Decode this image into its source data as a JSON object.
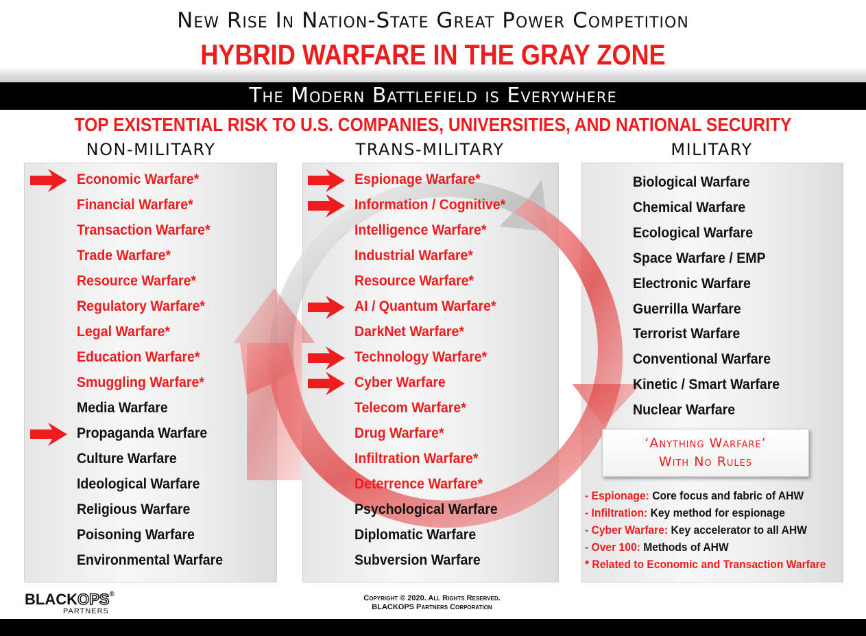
{
  "header": {
    "super_title": "New Rise In Nation-State Great Power Competition",
    "main_title": "HYBRID WARFARE IN THE GRAY ZONE",
    "band_title": "The Modern Battlefield is Everywhere",
    "risk_line": "TOP EXISTENTIAL RISK TO U.S. COMPANIES, UNIVERSITIES, AND NATIONAL SECURITY"
  },
  "colors": {
    "accent_red": "#ee1c1c",
    "text_black": "#111111",
    "panel_gray": "#eeeeee"
  },
  "columns": [
    {
      "heading": "NON-MILITARY",
      "items": [
        {
          "label": "Economic Warfare*",
          "color": "red",
          "arrow": true
        },
        {
          "label": "Financial Warfare*",
          "color": "red",
          "arrow": false
        },
        {
          "label": "Transaction Warfare*",
          "color": "red",
          "arrow": false
        },
        {
          "label": "Trade Warfare*",
          "color": "red",
          "arrow": false
        },
        {
          "label": "Resource Warfare*",
          "color": "red",
          "arrow": false
        },
        {
          "label": "Regulatory Warfare*",
          "color": "red",
          "arrow": false
        },
        {
          "label": "Legal Warfare*",
          "color": "red",
          "arrow": false
        },
        {
          "label": "Education Warfare*",
          "color": "red",
          "arrow": false
        },
        {
          "label": "Smuggling Warfare*",
          "color": "red",
          "arrow": false
        },
        {
          "label": "Media Warfare",
          "color": "black",
          "arrow": false
        },
        {
          "label": "Propaganda Warfare",
          "color": "black",
          "arrow": true
        },
        {
          "label": "Culture Warfare",
          "color": "black",
          "arrow": false
        },
        {
          "label": "Ideological Warfare",
          "color": "black",
          "arrow": false
        },
        {
          "label": "Religious Warfare",
          "color": "black",
          "arrow": false
        },
        {
          "label": "Poisoning Warfare",
          "color": "black",
          "arrow": false
        },
        {
          "label": "Environmental Warfare",
          "color": "black",
          "arrow": false
        }
      ]
    },
    {
      "heading": "TRANS-MILITARY",
      "items": [
        {
          "label": "Espionage Warfare*",
          "color": "red",
          "arrow": true
        },
        {
          "label": "Information / Cognitive*",
          "color": "red",
          "arrow": true
        },
        {
          "label": "Intelligence Warfare*",
          "color": "red",
          "arrow": false
        },
        {
          "label": "Industrial Warfare*",
          "color": "red",
          "arrow": false
        },
        {
          "label": "Resource Warfare*",
          "color": "red",
          "arrow": false
        },
        {
          "label": "AI / Quantum Warfare*",
          "color": "red",
          "arrow": true
        },
        {
          "label": "DarkNet Warfare*",
          "color": "red",
          "arrow": false
        },
        {
          "label": "Technology Warfare*",
          "color": "red",
          "arrow": true
        },
        {
          "label": "Cyber Warfare",
          "color": "red",
          "arrow": true
        },
        {
          "label": "Telecom Warfare*",
          "color": "red",
          "arrow": false
        },
        {
          "label": "Drug Warfare*",
          "color": "red",
          "arrow": false
        },
        {
          "label": "Infiltration Warfare*",
          "color": "red",
          "arrow": false
        },
        {
          "label": "Deterrence Warfare*",
          "color": "red",
          "arrow": false
        },
        {
          "label": "Psychological Warfare",
          "color": "black",
          "arrow": false
        },
        {
          "label": "Diplomatic Warfare",
          "color": "black",
          "arrow": false
        },
        {
          "label": "Subversion Warfare",
          "color": "black",
          "arrow": false
        }
      ]
    },
    {
      "heading": "MILITARY",
      "items": [
        {
          "label": "Biological Warfare",
          "color": "black",
          "arrow": false
        },
        {
          "label": "Chemical Warfare",
          "color": "black",
          "arrow": false
        },
        {
          "label": "Ecological Warfare",
          "color": "black",
          "arrow": false
        },
        {
          "label": "Space Warfare / EMP",
          "color": "black",
          "arrow": false
        },
        {
          "label": "Electronic Warfare",
          "color": "black",
          "arrow": false
        },
        {
          "label": "Guerrilla Warfare",
          "color": "black",
          "arrow": false
        },
        {
          "label": "Terrorist Warfare",
          "color": "black",
          "arrow": false
        },
        {
          "label": "Conventional Warfare",
          "color": "black",
          "arrow": false
        },
        {
          "label": "Kinetic / Smart Warfare",
          "color": "black",
          "arrow": false
        },
        {
          "label": "Nuclear Warfare",
          "color": "black",
          "arrow": false
        }
      ]
    }
  ],
  "anything_box": {
    "line1": "‘Anything Warfare’",
    "line2": "With No Rules"
  },
  "notes": [
    {
      "key": "- Espionage:",
      "text": " Core focus and fabric of AHW"
    },
    {
      "key": "- Infiltration:",
      "text": " Key method for espionage"
    },
    {
      "key": "- Cyber Warfare:",
      "text": " Key accelerator to all AHW"
    },
    {
      "key": "- Over 100:",
      "text": " Methods of AHW"
    },
    {
      "key": "* Related to Economic and Transaction Warfare",
      "text": ""
    }
  ],
  "footer": {
    "logo_black": "BLACK",
    "logo_ops": "OPS",
    "logo_reg": "®",
    "logo_sub": "PARTNERS",
    "copyright_line1": "Copyright © 2020. All Rights Reserved.",
    "copyright_line2": "BLACKOPS Partners Corporation"
  }
}
